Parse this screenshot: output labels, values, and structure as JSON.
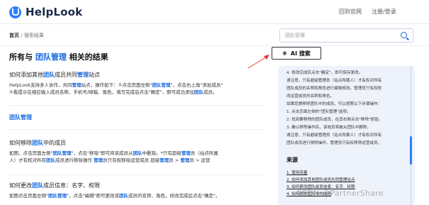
{
  "header": {
    "logo_text": "HelpLook",
    "nav": [
      "回到官网",
      "注册/登录"
    ]
  },
  "breadcrumb": {
    "home": "首页",
    "separator": "/",
    "current": "搜索结果"
  },
  "search": {
    "placeholder": "团队管理"
  },
  "results": {
    "heading": "所有与 团队管理 相关的结果",
    "items": [
      {
        "title": "如何添加其他团队成员共同管理站点",
        "snippet_1": "HelpLook支持多人协作，共同管理站点，操作如下：①点击页面左侧\"团队管理\"，点击右上角\"添加成员\"",
        "snippet_2": "②看提示在相应输入成员名称、手机号/邮箱、角色，填写完成后点击\"确定\"，即可成功添加团队成员。"
      },
      {
        "link": "团队管理"
      },
      {
        "title": "如何移除团队中的成员",
        "snippet_1": "如图，点击页面左侧\"团队管理\"，点击\"移除\"即可将该成员从团队中删除。*只有超级管理员（站点所属",
        "snippet_2": "人）才有权对所有团队成员进行移除操作 管理员只有权移除运营成员 超级管理员 > 管理员 > 运营"
      },
      {
        "title": "如何更改团队成员信息：名字、权限",
        "snippet_1": "如图点击页面左侧\"团队管理\"，点击\"编辑\"即可更改该团队成员的名称、角色，修改完成后点击\"确定\"。"
      }
    ]
  },
  "ai_search": {
    "label": "AI 搜索",
    "lines": [
      "4. 修改完成后点击\"确定\"，即可保存更改。",
      "请注意，只有超级管理员（站点所属人）才有权对所有",
      "团队成员的名称和角色进行编辑修改。管理员只有权修",
      "改运营成员的名称和角色。",
      "如果您想移除团队中的成员，可以按照以下步骤操作：",
      "1. 点击页面左侧的\"团队管理\"选项。",
      "2. 找到要移除的团队成员，在其右侧点击\"移除\"按钮。",
      "3. 确认移除操作后，该成员将被从团队中删除。",
      "请注意，只有超级管理员（站点所属人）才有权对所有",
      "团队成员进行移除操作。管理员只有权移除运营成员。"
    ],
    "source_heading": "来源",
    "sources": [
      "1. 使用流量",
      "2. 如何添加其他团队成员共同管理站点",
      "3. 如何更改团队成员信息：名字、权限",
      "4. 如何移除团队中的成员"
    ]
  },
  "watermark": "CSDN @PartnerShare"
}
